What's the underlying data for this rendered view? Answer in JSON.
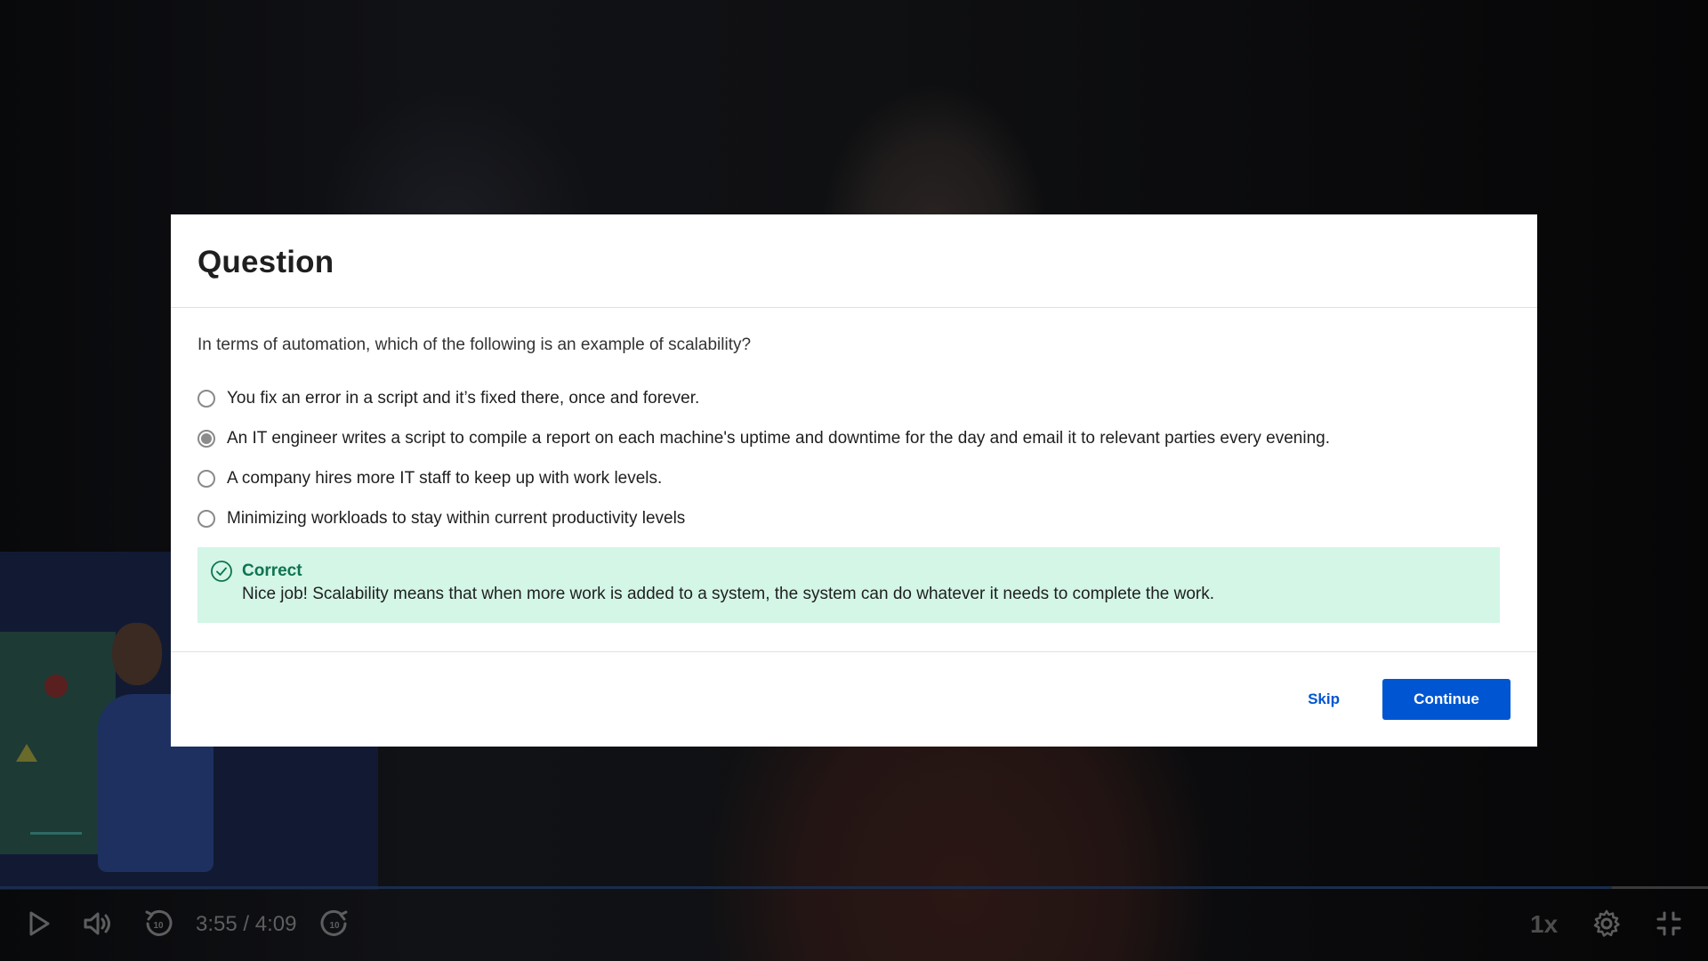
{
  "modal": {
    "title": "Question",
    "question": "In terms of automation, which of the following is an example of scalability?",
    "options": [
      {
        "label": "You fix an error in a script and it’s fixed there, once and forever.",
        "selected": false
      },
      {
        "label": "An IT engineer writes a script to compile a report on each machine's uptime and downtime for the day and email it to relevant parties every evening.",
        "selected": true
      },
      {
        "label": "A company hires more IT staff to keep up with work levels.",
        "selected": false
      },
      {
        "label": "Minimizing workloads to stay within current productivity levels",
        "selected": false
      }
    ],
    "feedback": {
      "status": "Correct",
      "message": "Nice job! Scalability means that when more work is added to a system, the system can do whatever it needs to complete the work.",
      "color": "#10734f",
      "background": "#d3f6e7"
    },
    "skip_label": "Skip",
    "continue_label": "Continue",
    "accent_color": "#0056d2"
  },
  "player": {
    "time_display": "3:55 / 4:09",
    "progress_fraction": 0.944,
    "speed_label": "1x",
    "icons": [
      "play-icon",
      "volume-icon",
      "rewind-10-icon",
      "forward-10-icon",
      "gear-icon",
      "exit-fullscreen-icon"
    ]
  }
}
